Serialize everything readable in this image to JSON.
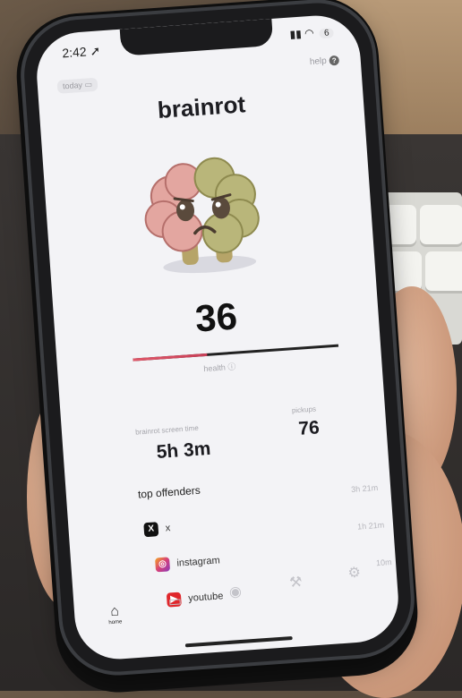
{
  "status_bar": {
    "time": "2:42",
    "battery": "6"
  },
  "header": {
    "today_label": "today",
    "help_label": "help"
  },
  "app": {
    "title": "brainrot"
  },
  "health": {
    "score": "36",
    "label": "health",
    "level": 0.36
  },
  "stats": {
    "screen_time_label": "brainrot screen time",
    "screen_time_value": "5h 3m",
    "pickups_label": "pickups",
    "pickups_value": "76"
  },
  "offenders": {
    "title": "top offenders",
    "items": [
      {
        "name": "x",
        "duration": "3h 21m",
        "icon": "x-icon",
        "color": "#111111"
      },
      {
        "name": "instagram",
        "duration": "1h 21m",
        "icon": "instagram-icon",
        "color": "#d6407a"
      },
      {
        "name": "youtube",
        "duration": "10m",
        "icon": "youtube-icon",
        "color": "#e0262b"
      }
    ]
  },
  "tabs": [
    {
      "label": "home",
      "icon": "home-icon",
      "active": true
    },
    {
      "label": "",
      "icon": "calendar-icon",
      "active": false
    },
    {
      "label": "",
      "icon": "compass-icon",
      "active": false
    },
    {
      "label": "",
      "icon": "hammer-icon",
      "active": false
    },
    {
      "label": "",
      "icon": "gear-icon",
      "active": false
    }
  ]
}
